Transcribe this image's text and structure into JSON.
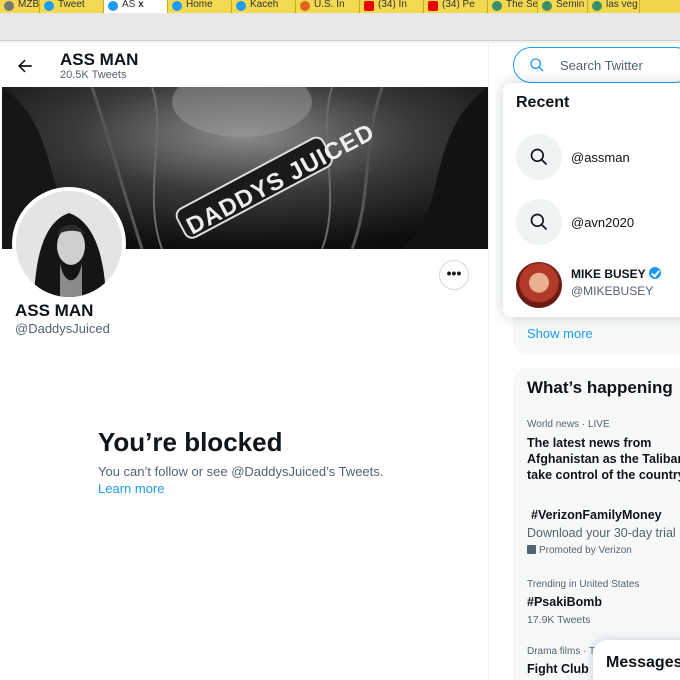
{
  "browser": {
    "tabs": [
      {
        "label": "MZBot",
        "icon": "page-icon"
      },
      {
        "label": "Tweet",
        "icon": "twitter-icon"
      },
      {
        "label": "AS",
        "icon": "twitter-icon",
        "active": true,
        "close": "x"
      },
      {
        "label": "Home",
        "icon": "twitter-icon"
      },
      {
        "label": "Kaceh",
        "icon": "twitter-icon"
      },
      {
        "label": "U.S. In",
        "icon": "x-icon"
      },
      {
        "label": "(34) In",
        "icon": "youtube-icon"
      },
      {
        "label": "(34) Pe",
        "icon": "youtube-icon"
      },
      {
        "label": "The Se",
        "icon": "globe-icon"
      },
      {
        "label": "Semin",
        "icon": "globe-icon"
      },
      {
        "label": "las veg",
        "icon": "globe-icon"
      }
    ],
    "colors": {
      "tab_bar": "#f1d64b",
      "twitter_blue": "#1d9bf0"
    }
  },
  "profile": {
    "header_name": "ASS MAN",
    "tweet_count": "20.5K Tweets",
    "banner_text": "DADDYS JUICED",
    "display_name": "ASS MAN",
    "handle": "@DaddysJuiced",
    "more_label": "•••",
    "blocked_title": "You’re blocked",
    "blocked_message": "You can’t follow or see @DaddysJuiced’s Tweets.",
    "learn_more": "Learn more"
  },
  "search": {
    "placeholder": "Search Twitter",
    "recent_title": "Recent",
    "recent_items": [
      "@assman",
      "@avn2020"
    ],
    "user": {
      "name": "MIKE BUSEY",
      "handle": "@MIKEBUSEY",
      "verified": true
    },
    "show_more": "Show more"
  },
  "happening": {
    "title": "What’s happening",
    "trends": [
      {
        "meta": "World news · LIVE",
        "text": "The latest news from Afghanistan as the Taliban take control of the country"
      },
      {
        "text": "#VerizonFamilyMoney",
        "sub": "Download your 30-day trial",
        "promo": "Promoted by Verizon"
      },
      {
        "meta": "Trending in United States",
        "text": "#PsakiBomb",
        "count": "17.9K Tweets"
      },
      {
        "meta": "Drama films · Trending",
        "text": "Fight Club"
      }
    ]
  },
  "messages": {
    "label": "Messages"
  }
}
